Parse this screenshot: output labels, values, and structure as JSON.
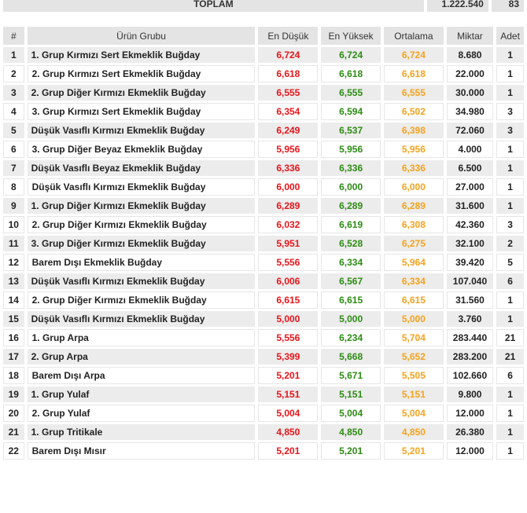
{
  "totals": {
    "label": "TOPLAM",
    "amount": "1.222.540",
    "count": "83"
  },
  "colors": {
    "low": "#e8151b",
    "high": "#2d8b14",
    "avg": "#f5a21c"
  },
  "headers": {
    "index": "#",
    "group": "Ürün Grubu",
    "low": "En Düşük",
    "high": "En Yüksek",
    "avg": "Ortalama",
    "amount": "Miktar",
    "count": "Adet"
  },
  "rows": [
    {
      "idx": "1",
      "name": "1. Grup Kırmızı Sert Ekmeklik Buğday",
      "low": "6,724",
      "high": "6,724",
      "avg": "6,724",
      "amount": "8.680",
      "count": "1"
    },
    {
      "idx": "2",
      "name": "2. Grup Kırmızı Sert Ekmeklik Buğday",
      "low": "6,618",
      "high": "6,618",
      "avg": "6,618",
      "amount": "22.000",
      "count": "1"
    },
    {
      "idx": "3",
      "name": "2. Grup Diğer Kırmızı Ekmeklik Buğday",
      "low": "6,555",
      "high": "6,555",
      "avg": "6,555",
      "amount": "30.000",
      "count": "1"
    },
    {
      "idx": "4",
      "name": "3. Grup Kırmızı Sert Ekmeklik Buğday",
      "low": "6,354",
      "high": "6,594",
      "avg": "6,502",
      "amount": "34.980",
      "count": "3"
    },
    {
      "idx": "5",
      "name": "Düşük Vasıflı Kırmızı Ekmeklik Buğday",
      "low": "6,249",
      "high": "6,537",
      "avg": "6,398",
      "amount": "72.060",
      "count": "3"
    },
    {
      "idx": "6",
      "name": "3. Grup Diğer Beyaz Ekmeklik Buğday",
      "low": "5,956",
      "high": "5,956",
      "avg": "5,956",
      "amount": "4.000",
      "count": "1"
    },
    {
      "idx": "7",
      "name": "Düşük Vasıflı Beyaz Ekmeklik Buğday",
      "low": "6,336",
      "high": "6,336",
      "avg": "6,336",
      "amount": "6.500",
      "count": "1"
    },
    {
      "idx": "8",
      "name": "Düşük Vasıflı Kırmızı Ekmeklik Buğday",
      "low": "6,000",
      "high": "6,000",
      "avg": "6,000",
      "amount": "27.000",
      "count": "1"
    },
    {
      "idx": "9",
      "name": "1. Grup Diğer Kırmızı Ekmeklik Buğday",
      "low": "6,289",
      "high": "6,289",
      "avg": "6,289",
      "amount": "31.600",
      "count": "1"
    },
    {
      "idx": "10",
      "name": "2. Grup Diğer Kırmızı Ekmeklik Buğday",
      "low": "6,032",
      "high": "6,619",
      "avg": "6,308",
      "amount": "42.360",
      "count": "3"
    },
    {
      "idx": "11",
      "name": "3. Grup Diğer Kırmızı Ekmeklik Buğday",
      "low": "5,951",
      "high": "6,528",
      "avg": "6,275",
      "amount": "32.100",
      "count": "2"
    },
    {
      "idx": "12",
      "name": "Barem Dışı Ekmeklik Buğday",
      "low": "5,556",
      "high": "6,334",
      "avg": "5,964",
      "amount": "39.420",
      "count": "5"
    },
    {
      "idx": "13",
      "name": "Düşük Vasıflı Kırmızı Ekmeklik Buğday",
      "low": "6,006",
      "high": "6,567",
      "avg": "6,334",
      "amount": "107.040",
      "count": "6"
    },
    {
      "idx": "14",
      "name": "2. Grup Diğer Kırmızı Ekmeklik Buğday",
      "low": "6,615",
      "high": "6,615",
      "avg": "6,615",
      "amount": "31.560",
      "count": "1"
    },
    {
      "idx": "15",
      "name": "Düşük Vasıflı Kırmızı Ekmeklik Buğday",
      "low": "5,000",
      "high": "5,000",
      "avg": "5,000",
      "amount": "3.760",
      "count": "1"
    },
    {
      "idx": "16",
      "name": "1. Grup Arpa",
      "low": "5,556",
      "high": "6,234",
      "avg": "5,704",
      "amount": "283.440",
      "count": "21"
    },
    {
      "idx": "17",
      "name": "2. Grup Arpa",
      "low": "5,399",
      "high": "5,668",
      "avg": "5,652",
      "amount": "283.200",
      "count": "21"
    },
    {
      "idx": "18",
      "name": "Barem Dışı Arpa",
      "low": "5,201",
      "high": "5,671",
      "avg": "5,505",
      "amount": "102.660",
      "count": "6"
    },
    {
      "idx": "19",
      "name": "1. Grup Yulaf",
      "low": "5,151",
      "high": "5,151",
      "avg": "5,151",
      "amount": "9.800",
      "count": "1"
    },
    {
      "idx": "20",
      "name": "2. Grup Yulaf",
      "low": "5,004",
      "high": "5,004",
      "avg": "5,004",
      "amount": "12.000",
      "count": "1"
    },
    {
      "idx": "21",
      "name": "1. Grup Tritikale",
      "low": "4,850",
      "high": "4,850",
      "avg": "4,850",
      "amount": "26.380",
      "count": "1"
    },
    {
      "idx": "22",
      "name": "Barem Dışı Mısır",
      "low": "5,201",
      "high": "5,201",
      "avg": "5,201",
      "amount": "12.000",
      "count": "1"
    }
  ]
}
